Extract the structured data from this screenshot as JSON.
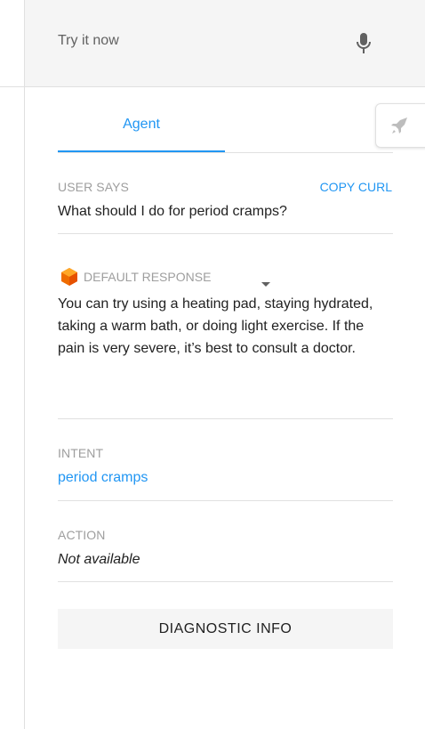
{
  "try_bar": {
    "placeholder": "Try it now",
    "mic_icon": "microphone-icon"
  },
  "tabs": [
    {
      "label": "Agent",
      "active": true
    }
  ],
  "side_button": {
    "icon": "rocket-icon"
  },
  "user_says": {
    "label": "USER SAYS",
    "copy_curl": "COPY CURL",
    "text": "What should I do for period cramps?"
  },
  "default_response": {
    "label": "DEFAULT RESPONSE",
    "icon": "cube-icon",
    "text": "You can try using a heating pad, staying hydrated, taking a warm bath, or doing light exercise. If the pain is very severe, it’s best to consult a doctor."
  },
  "intent": {
    "label": "INTENT",
    "value": "period cramps"
  },
  "action": {
    "label": "ACTION",
    "value": "Not available"
  },
  "diagnostic": {
    "label": "DIAGNOSTIC INFO"
  },
  "colors": {
    "accent": "#2196f3",
    "cube": "#ef6c00",
    "muted": "#9e9e9e"
  }
}
